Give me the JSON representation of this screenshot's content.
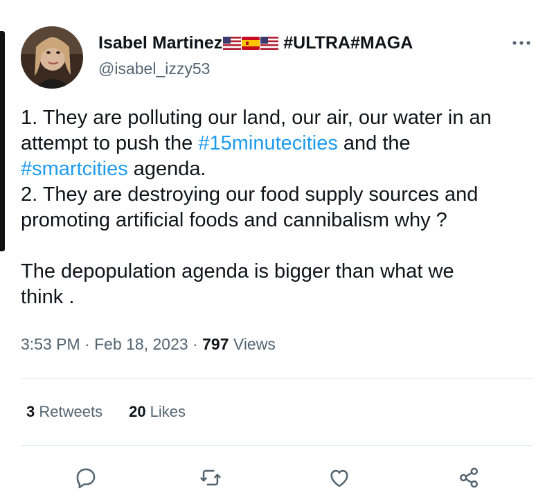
{
  "tweet": {
    "author": {
      "display_name": "Isabel Martinez",
      "flags": [
        "us-flag",
        "spain-flag",
        "us-flag"
      ],
      "name_tag": "#ULTRA#MAGA",
      "handle": "@isabel_izzy53"
    },
    "more_icon": "more-options-icon",
    "body": {
      "line1": "1. They are polluting our land, our air, our water in an",
      "line2_pre": "attempt to push the ",
      "hashtag1": "#15minutecities",
      "line2_post": " and the",
      "hashtag2": "#smartcities",
      "line3_post": " agenda.",
      "line4": "2. They are destroying our food supply sources and",
      "line5": "promoting artificial foods and cannibalism why ?",
      "line6": "The depopulation agenda is bigger than what we",
      "line7": "think ."
    },
    "meta": {
      "time": "3:53 PM",
      "separator": " · ",
      "date": "Feb 18, 2023",
      "views_count": "797",
      "views_label": " Views"
    },
    "stats": {
      "retweets_count": "3",
      "retweets_label": " Retweets",
      "likes_count": "20",
      "likes_label": " Likes"
    },
    "actions": [
      "reply-icon",
      "retweet-icon",
      "like-icon",
      "share-icon"
    ]
  },
  "colors": {
    "text": "#0f1419",
    "secondary": "#536471",
    "link": "#1d9bf0",
    "divider": "#e6ecf0"
  }
}
